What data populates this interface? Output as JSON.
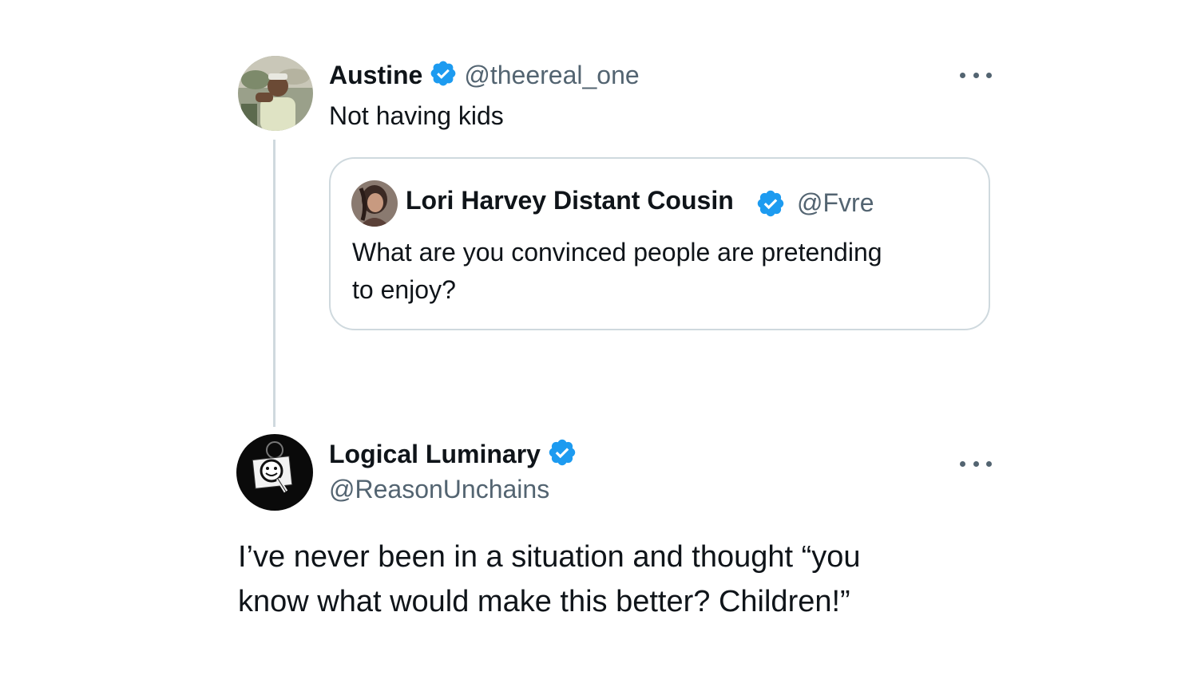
{
  "main_tweet": {
    "display_name": "Austine",
    "handle": "@theereal_one",
    "text": "Not having kids",
    "verified": true,
    "more_icon": "ellipsis-icon"
  },
  "quoted_tweet": {
    "display_name": "Lori Harvey Distant Cousin",
    "handle": "@Fvre",
    "text_line1": "What are you convinced people are pretending",
    "text_line2": "to enjoy?",
    "verified": true
  },
  "reply_tweet": {
    "display_name": "Logical Luminary",
    "handle": "@ReasonUnchains",
    "text_line1": "I’ve never been in a situation and thought “you",
    "text_line2": "know what would make this better? Children!”",
    "verified": true,
    "more_icon": "ellipsis-icon"
  },
  "colors": {
    "verified_blue": "#1d9bf0",
    "secondary_text": "#536471",
    "primary_text": "#0f1419",
    "border": "#cfd9de"
  }
}
